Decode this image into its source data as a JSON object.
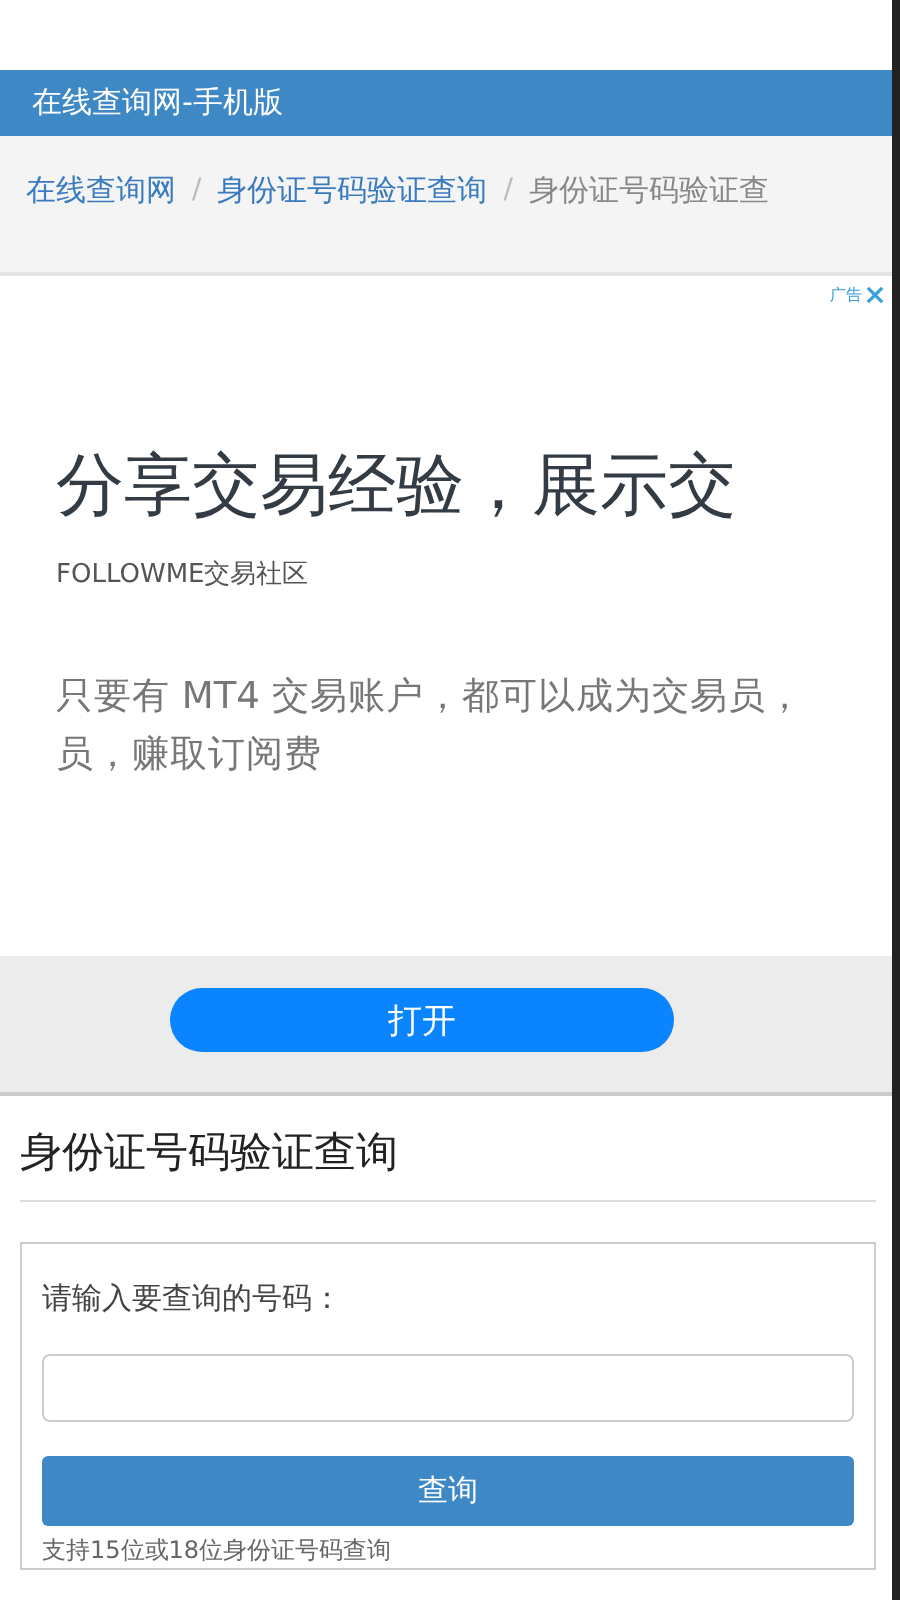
{
  "header": {
    "title": "在线查询网-手机版"
  },
  "breadcrumb": [
    {
      "label": "在线查询网",
      "kind": "link"
    },
    {
      "label": "/",
      "kind": "separator"
    },
    {
      "label": "身份证号码验证查询",
      "kind": "link"
    },
    {
      "label": "/",
      "kind": "separator"
    },
    {
      "label": "身份证号码验证查",
      "kind": "current"
    }
  ],
  "ad": {
    "badge": "广告",
    "headline": "分享交易经验，展示交",
    "brand": "FOLLOWME交易社区",
    "body_lines": [
      "只要有 MT4 交易账户，都可以成为交易员，",
      "员，赚取订阅费"
    ],
    "button": "打开"
  },
  "section": {
    "title": "身份证号码验证查询"
  },
  "form": {
    "label": "请输入要查询的号码：",
    "button": "查询",
    "note": "支持15位或18位身份证号码查询"
  }
}
